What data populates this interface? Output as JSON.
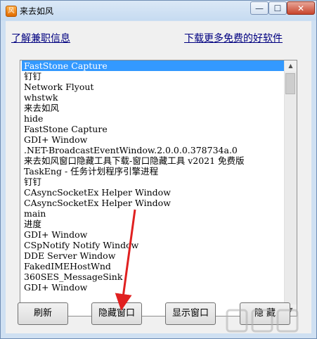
{
  "window": {
    "title": "来去如风",
    "icon_glyph": "风",
    "min_glyph": "—",
    "max_glyph": "☐",
    "close_glyph": "✕"
  },
  "links": {
    "part_time": "了解兼职信息",
    "download_more": "下载更多免费的好软件"
  },
  "list": {
    "selected_index": 0,
    "items": [
      "FastStone Capture",
      "钉钉",
      "Network Flyout",
      "whstwk",
      "来去如风",
      "hide",
      "FastStone Capture",
      "GDI+ Window",
      ".NET-BroadcastEventWindow.2.0.0.0.378734a.0",
      "来去如风窗口隐藏工具下载-窗口隐藏工具 v2021 免费版",
      "TaskEng - 任务计划程序引擎进程",
      "钉钉",
      "CAsyncSocketEx Helper Window",
      "CAsyncSocketEx Helper Window",
      "main",
      "进度",
      "GDI+ Window",
      "CSpNotify Notify Window",
      "DDE Server Window",
      "FakedIMEHostWnd",
      "360SES_MessageSink",
      "GDI+ Window"
    ]
  },
  "buttons": {
    "refresh": "刷新",
    "hide_window": "隐藏窗口",
    "show_window": "显示窗口",
    "hide": "隐 藏"
  },
  "scrollbar": {
    "up_glyph": "▲",
    "down_glyph": "▼"
  },
  "colors": {
    "selection": "#3399ff",
    "link": "#000080",
    "annotation_arrow": "#e02020"
  }
}
